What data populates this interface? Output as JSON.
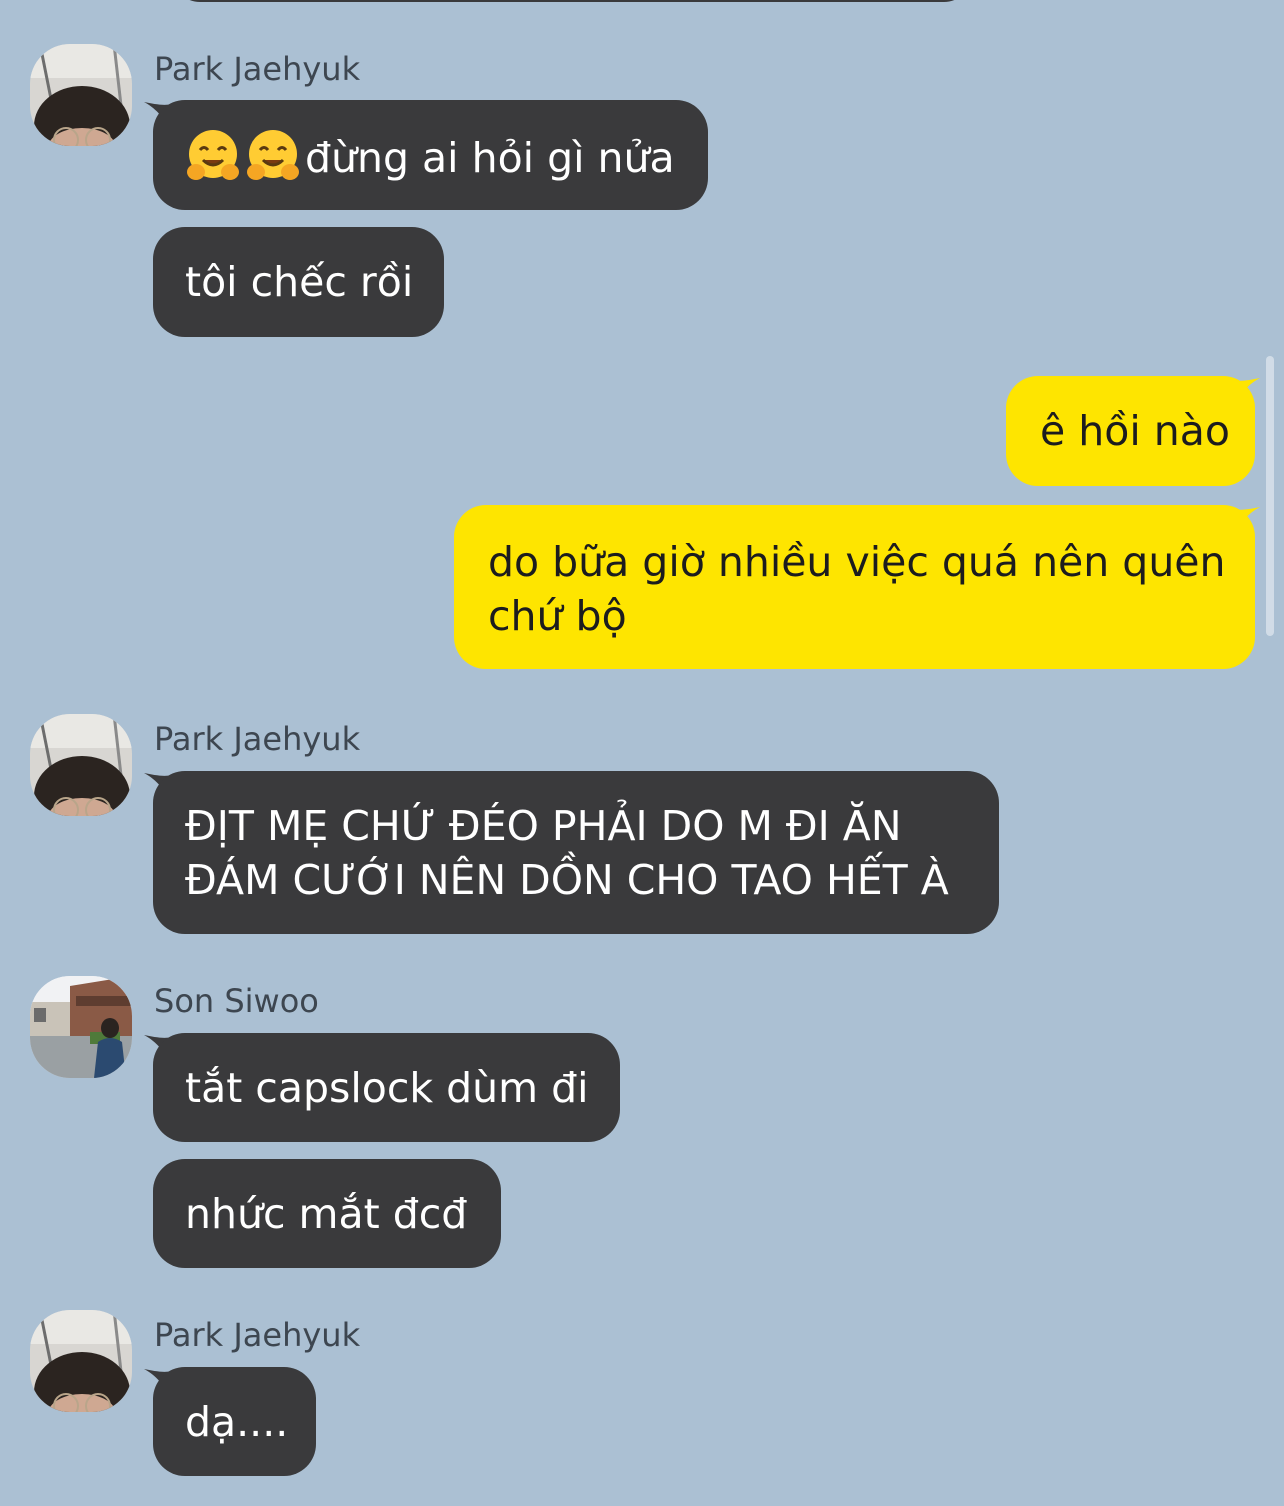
{
  "messages": {
    "group1": {
      "sender": "Park Jaehyuk",
      "msg1_text": "đừng ai hỏi gì nửa",
      "msg2_text": "tôi chếc rồi"
    },
    "outgoing": {
      "msg1_text": "ê hồi nào",
      "msg2_line1": "do bữa giờ nhiều việc quá nên quên",
      "msg2_line2": "chứ bộ"
    },
    "group2": {
      "sender": "Park Jaehyuk",
      "msg1_line1": "ĐỊT MẸ CHỨ ĐÉO PHẢI DO M ĐI ĂN",
      "msg1_line2": "ĐÁM CƯỚI NÊN DỒN CHO TAO HẾT À"
    },
    "group3": {
      "sender": "Son Siwoo",
      "msg1_text": "tắt capslock dùm đi",
      "msg2_text": "nhức mắt đcđ"
    },
    "group4": {
      "sender": "Park Jaehyuk",
      "msg1_text": "dạ...."
    }
  },
  "icons": {
    "emoji": "hugging-face-emoji"
  },
  "colors": {
    "background": "#abc0d3",
    "incoming_bubble": "#3a3a3c",
    "outgoing_bubble": "#fee500",
    "sender_name": "#3d4650"
  }
}
